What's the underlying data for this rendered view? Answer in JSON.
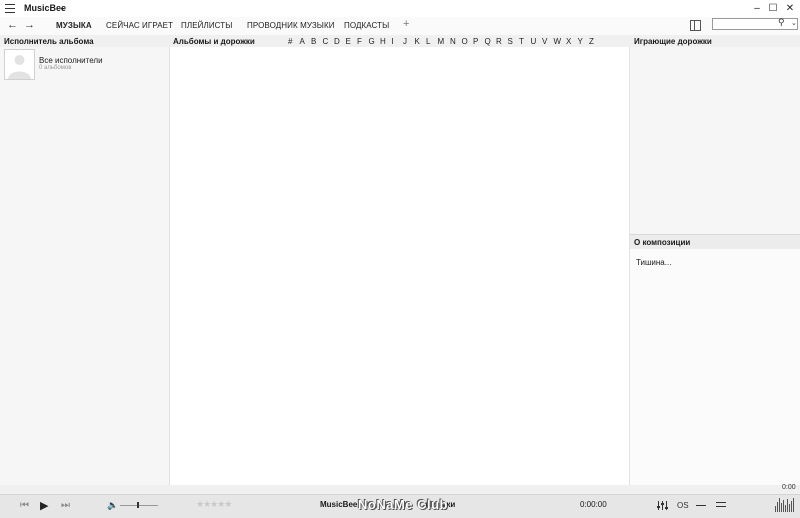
{
  "titlebar": {
    "app_name": "MusicBee",
    "dropdown_glyph": "⌄",
    "minimize_glyph": "–",
    "maximize_glyph": "☐",
    "close_glyph": "✕"
  },
  "nav": {
    "back_glyph": "←",
    "forward_glyph": "→"
  },
  "tabs": {
    "music": "МУЗЫКА",
    "now_playing": "СЕЙЧАС ИГРАЕТ",
    "playlists": "ПЛЕЙЛИСТЫ",
    "music_explorer": "ПРОВОДНИК МУЗЫКИ",
    "podcasts": "ПОДКАСТЫ",
    "add": "+"
  },
  "search": {
    "value": "",
    "dropdown_glyph": "⌄"
  },
  "headers": {
    "album_artist": "Исполнитель альбома",
    "albums_tracks": "Альбомы и дорожки",
    "playing_tracks": "Играющие дорожки",
    "about_track": "О композиции"
  },
  "alphabet": [
    "#",
    "A",
    "B",
    "C",
    "D",
    "E",
    "F",
    "G",
    "H",
    "I",
    "J",
    "K",
    "L",
    "M",
    "N",
    "O",
    "P",
    "Q",
    "R",
    "S",
    "T",
    "U",
    "V",
    "W",
    "X",
    "Y",
    "Z"
  ],
  "artists": {
    "all_label": "Все исполнители",
    "all_count": "0 альбомов"
  },
  "about": {
    "text": "Тишина..."
  },
  "status": {
    "elapsed": "0:00"
  },
  "player": {
    "prev_glyph": "⏮",
    "play_glyph": "▶",
    "next_glyph": "⏭",
    "volume_glyph": "🔈",
    "volume_level": 0.45,
    "rating_glyph": "★★★★★",
    "rating_value": 0,
    "now_playing": "MusicBee",
    "now_playing_suffix": "музыки",
    "time": "0:00:00",
    "os_label": "OS"
  },
  "watermark": "NoNaMe Club",
  "colors": {
    "background": "#f0f0f0",
    "panel": "#ffffff",
    "player_bar": "#e6e6e6"
  }
}
